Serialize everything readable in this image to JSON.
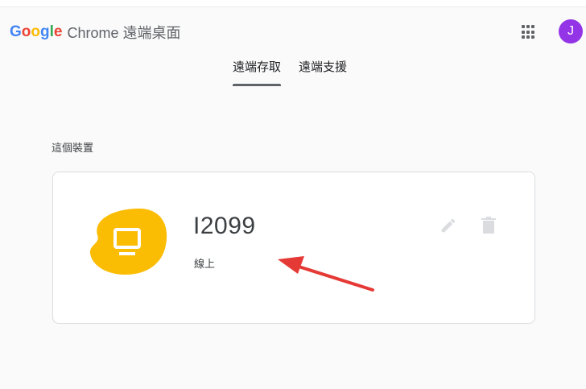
{
  "app": {
    "logo_letters": [
      "G",
      "o",
      "o",
      "g",
      "l",
      "e"
    ],
    "logo_colors": [
      "#4285F4",
      "#EA4335",
      "#FBBC05",
      "#4285F4",
      "#34A853",
      "#EA4335"
    ],
    "product_name": "Chrome 遠端桌面"
  },
  "header": {
    "apps_icon": "grid-apps-icon",
    "avatar_letter": "J",
    "avatar_color": "#9334e6"
  },
  "tabs": [
    {
      "label": "遠端存取",
      "active": true
    },
    {
      "label": "遠端支援",
      "active": false
    }
  ],
  "section": {
    "title": "這個裝置"
  },
  "device": {
    "name": "I2099",
    "status": "線上",
    "icon": "monitor-icon",
    "icon_bg_color": "#fbbc04",
    "actions": [
      "edit-icon",
      "delete-icon"
    ]
  },
  "annotation": {
    "arrow_color": "#e53935"
  }
}
